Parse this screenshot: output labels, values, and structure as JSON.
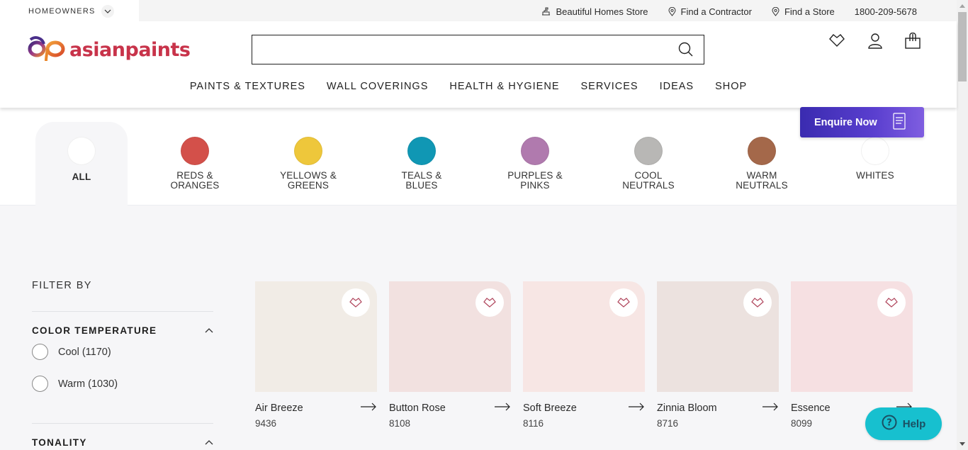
{
  "utility_bar": {
    "audience": "HOMEOWNERS",
    "links": [
      {
        "label": "Beautiful Homes Store",
        "icon": "store-icon"
      },
      {
        "label": "Find a Contractor",
        "icon": "location-pin-icon"
      },
      {
        "label": "Find a Store",
        "icon": "location-pin-icon"
      },
      {
        "label": "1800-209-5678",
        "icon": ""
      }
    ]
  },
  "header": {
    "brand": "asianpaints",
    "search": {
      "value": "",
      "placeholder": ""
    },
    "icons": [
      "wishlist-heart-icon",
      "user-account-icon",
      "shopping-bag-icon"
    ]
  },
  "nav": {
    "items": [
      "PAINTS & TEXTURES",
      "WALL COVERINGS",
      "HEALTH & HYGIENE",
      "SERVICES",
      "IDEAS",
      "SHOP"
    ]
  },
  "enquire": {
    "label": "Enquire Now"
  },
  "categories": [
    {
      "label": "ALL",
      "color": "#ffffff",
      "active": true
    },
    {
      "label": "REDS & ORANGES",
      "color": "#d3504a"
    },
    {
      "label": "YELLOWS & GREENS",
      "color": "#eec73b"
    },
    {
      "label": "TEALS & BLUES",
      "color": "#1097b4"
    },
    {
      "label": "PURPLES & PINKS",
      "color": "#b07aae"
    },
    {
      "label": "COOL NEUTRALS",
      "color": "#b8b7b5"
    },
    {
      "label": "WARM NEUTRALS",
      "color": "#a4684a"
    },
    {
      "label": "WHITES",
      "color": "#ffffff"
    }
  ],
  "filters": {
    "title": "FILTER BY",
    "groups": [
      {
        "title": "COLOR TEMPERATURE",
        "expanded": true,
        "options": [
          {
            "label": "Cool (1170)",
            "checked": false
          },
          {
            "label": "Warm (1030)",
            "checked": false
          }
        ]
      },
      {
        "title": "TONALITY",
        "expanded": true,
        "options": []
      }
    ]
  },
  "products": [
    {
      "name": "Air Breeze",
      "code": "9436",
      "color": "#f1ece6"
    },
    {
      "name": "Button Rose",
      "code": "8108",
      "color": "#f2e1e0"
    },
    {
      "name": "Soft Breeze",
      "code": "8116",
      "color": "#f7e6e4"
    },
    {
      "name": "Zinnia Bloom",
      "code": "8716",
      "color": "#ece2df"
    },
    {
      "name": "Essence",
      "code": "8099",
      "color": "#f6e0e2"
    }
  ],
  "help": {
    "label": "Help"
  },
  "colors": {
    "brand_red": "#c8334a",
    "enquire_gradient_start": "#3a2bb0",
    "enquire_gradient_end": "#7f5ee0",
    "help_bg": "#17c0cf",
    "heart_stroke": "#b0455c"
  }
}
